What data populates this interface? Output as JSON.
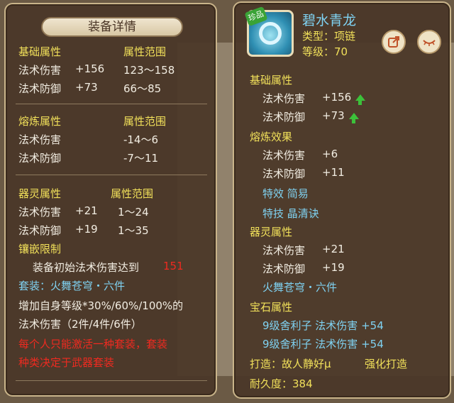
{
  "left": {
    "title": "装备详情",
    "base": {
      "header": "基础属性",
      "range_header": "属性范围",
      "rows": [
        {
          "name": "法术伤害",
          "value": "+156",
          "range": "123～158"
        },
        {
          "name": "法术防御",
          "value": "+73",
          "range": "66～85"
        }
      ]
    },
    "smelt": {
      "header": "熔炼属性",
      "range_header": "属性范围",
      "rows": [
        {
          "name": "法术伤害",
          "range": "-14～6"
        },
        {
          "name": "法术防御",
          "range": "-7～11"
        }
      ]
    },
    "spirit": {
      "header": "器灵属性",
      "range_header": "属性范围",
      "rows": [
        {
          "name": "法术伤害",
          "value": "+21",
          "range": "1～24"
        },
        {
          "name": "法术防御",
          "value": "+19",
          "range": "1～35"
        }
      ]
    },
    "inlay": {
      "header": "镶嵌限制",
      "text": "装备初始法术伤害达到",
      "value": "151"
    },
    "set": {
      "label": "套装：火舞苍穹・六件",
      "desc1": "增加自身等级*30%/60%/100%的",
      "desc2": "法术伤害（2件/4件/6件）",
      "warn1": "每个人只能激活一种套装，套装",
      "warn2": "种类决定于武器套装"
    }
  },
  "right": {
    "item_name": "碧水青龙",
    "badge": "珍品",
    "type": "类型：项链",
    "level": "等级：70",
    "base": {
      "header": "基础属性",
      "rows": [
        {
          "name": "法术伤害",
          "value": "+156"
        },
        {
          "name": "法术防御",
          "value": "+73"
        }
      ]
    },
    "smelt": {
      "header": "熔炼效果",
      "rows": [
        {
          "name": "法术伤害",
          "value": "+6"
        },
        {
          "name": "法术防御",
          "value": "+11"
        }
      ],
      "effect": "特效  简易",
      "skill": "特技  晶清诀"
    },
    "spirit": {
      "header": "器灵属性",
      "rows": [
        {
          "name": "法术伤害",
          "value": "+21"
        },
        {
          "name": "法术防御",
          "value": "+19"
        }
      ],
      "set": "火舞苍穹・六件"
    },
    "gem": {
      "header": "宝石属性",
      "rows": [
        "9级舍利子  法术伤害  +54",
        "9级舍利子  法术伤害  +54"
      ]
    },
    "forge": "打造：故人静好µ",
    "enhance": "强化打造",
    "durability": "耐久度：384"
  },
  "colors": {
    "accent_yellow": "#f1e05a",
    "accent_blue": "#7fd2f2",
    "warning_red": "#ef2a20",
    "up_green": "#3cc13a"
  }
}
